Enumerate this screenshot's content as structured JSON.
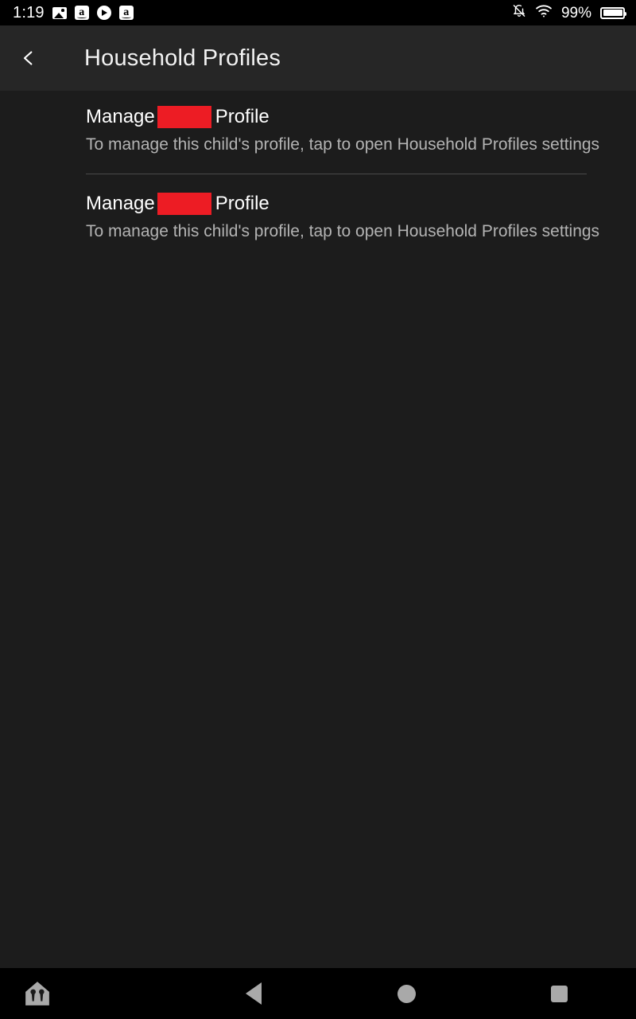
{
  "status_bar": {
    "time": "1:19",
    "battery_percent": "99%",
    "left_icons": [
      "photo-icon",
      "amazon-app-icon",
      "play-circle-icon",
      "amazon-app-icon"
    ],
    "right_icons": [
      "notifications-off-icon",
      "wifi-icon",
      "battery-icon"
    ],
    "amazon_glyph": "a"
  },
  "app_bar": {
    "back_icon": "chevron-left-icon",
    "title": "Household Profiles"
  },
  "colors": {
    "redaction": "#ED1C24",
    "background": "#1C1C1C",
    "app_bar_background": "#262626",
    "nav_bar_background": "#000000",
    "primary_text": "#FFFFFF",
    "secondary_text": "#B3B3B3",
    "divider": "#4A4A4A"
  },
  "profiles": [
    {
      "title_prefix": "Manage",
      "name_redacted": "",
      "title_suffix": "Profile",
      "description": "To manage this child's profile, tap to open Household Profiles settings"
    },
    {
      "title_prefix": "Manage",
      "name_redacted": "",
      "title_suffix": "Profile",
      "description": "To manage this child's profile, tap to open Household Profiles settings"
    }
  ],
  "nav_bar": {
    "items": [
      {
        "name": "household-kids-icon"
      },
      {
        "name": "back-icon"
      },
      {
        "name": "home-icon"
      },
      {
        "name": "recents-icon"
      }
    ]
  }
}
